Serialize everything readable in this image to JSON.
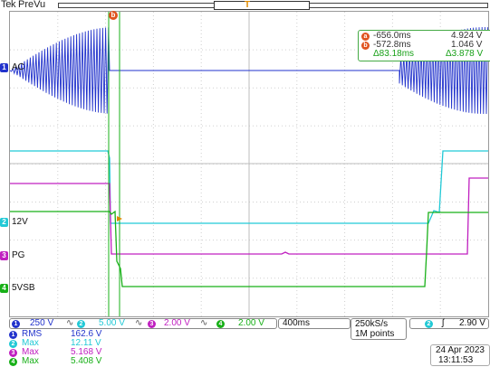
{
  "header": {
    "brand": "Tek",
    "mode": "PreVu",
    "trigger_marker": "T"
  },
  "cursor_flag": "b",
  "cursor_readout": {
    "a": {
      "badge": "a",
      "time": "-656.0ms",
      "volt": "4.924 V"
    },
    "b": {
      "badge": "b",
      "time": "-572.8ms",
      "volt": "1.046 V"
    },
    "delta": {
      "time": "Δ83.18ms",
      "volt": "Δ3.878 V"
    }
  },
  "channel_labels": {
    "ac": "AC",
    "v12": "12V",
    "pg": "PG",
    "v5sb": "5VSB"
  },
  "channel_badges": {
    "ch1": "1",
    "ch2": "2",
    "ch3": "3",
    "ch4": "4"
  },
  "scales": [
    {
      "badge": "1",
      "value": "250 V",
      "color": "#2233cc"
    },
    {
      "badge": "2",
      "value": "5.00 V",
      "color": "#22c9d6"
    },
    {
      "badge": "3",
      "value": "2.00 V",
      "color": "#c020c0"
    },
    {
      "badge": "4",
      "value": "2.00 V",
      "color": "#18b018"
    }
  ],
  "scale_symbols": [
    "∿",
    "∿",
    "∿"
  ],
  "timebase": "400ms",
  "sample_rate": "250kS/s",
  "record_length": "1M points",
  "trigger": {
    "badge": "2",
    "slope": "ʃ",
    "level": "2.90 V"
  },
  "measurements": [
    {
      "badge": "1",
      "name": "RMS",
      "value": "162.6 V",
      "color": "#2233cc"
    },
    {
      "badge": "2",
      "name": "Max",
      "value": "12.11 V",
      "color": "#22c9d6"
    },
    {
      "badge": "3",
      "name": "Max",
      "value": "5.168 V",
      "color": "#c020c0"
    },
    {
      "badge": "4",
      "name": "Max",
      "value": "5.408 V",
      "color": "#18b018"
    }
  ],
  "date": "24 Apr  2023",
  "time": "13:11:53",
  "colors": {
    "ch1": "#2233cc",
    "ch2": "#22c9d6",
    "ch3": "#c020c0",
    "ch4": "#18b018",
    "cursor": "#18b018",
    "cursor_badge": "#e0531f"
  }
}
